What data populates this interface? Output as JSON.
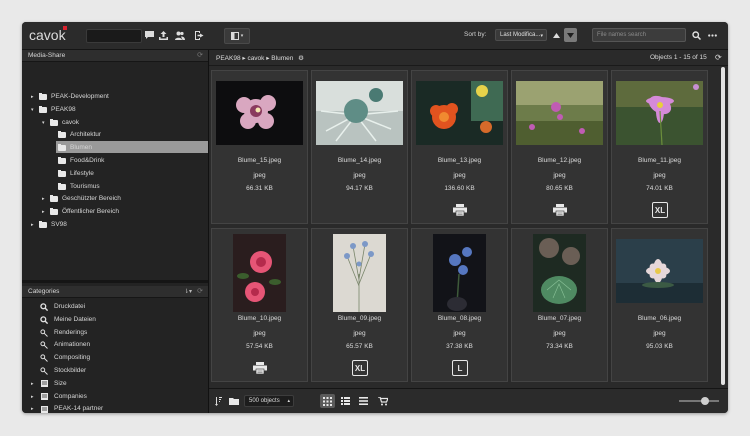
{
  "app": {
    "logo": "cavok"
  },
  "toolbar": {
    "sort_label": "Sort by:",
    "sort_value": "Last Modifica...",
    "search_placeholder": "File names search"
  },
  "media_share": {
    "title": "Media-Share",
    "tree": [
      {
        "label": "PEAK-Development",
        "level": 0,
        "expanded": false
      },
      {
        "label": "PEAK98",
        "level": 0,
        "expanded": true
      },
      {
        "label": "cavok",
        "level": 1,
        "expanded": true
      },
      {
        "label": "Architektur",
        "level": 2,
        "expanded": false
      },
      {
        "label": "Blumen",
        "level": 2,
        "expanded": false,
        "selected": true
      },
      {
        "label": "Food&Drink",
        "level": 2,
        "expanded": false
      },
      {
        "label": "Lifestyle",
        "level": 2,
        "expanded": false
      },
      {
        "label": "Tourismus",
        "level": 2,
        "expanded": false
      },
      {
        "label": "Geschützter Bereich",
        "level": 1,
        "expanded": false
      },
      {
        "label": "Öffentlicher Bereich",
        "level": 1,
        "expanded": false
      },
      {
        "label": "SV98",
        "level": 0,
        "expanded": false
      }
    ]
  },
  "categories": {
    "title": "Categories",
    "items": [
      {
        "label": "Druckdatei",
        "icon": "search-icon"
      },
      {
        "label": "Meine Dateien",
        "icon": "search-icon"
      },
      {
        "label": "Renderings",
        "icon": "smart-search-icon"
      },
      {
        "label": "Animationen",
        "icon": "smart-search-icon"
      },
      {
        "label": "Compositing",
        "icon": "smart-search-icon"
      },
      {
        "label": "Stockbilder",
        "icon": "smart-search-icon"
      },
      {
        "label": "Size",
        "icon": "list-icon"
      },
      {
        "label": "Companies",
        "icon": "list-icon"
      },
      {
        "label": "PEAK-14 partner",
        "icon": "list-icon"
      },
      {
        "label": "Dogawist Marketing",
        "icon": "list-icon"
      }
    ]
  },
  "breadcrumb": {
    "text": "PEAK98 ▸ cavok ▸ Blumen"
  },
  "objects": {
    "count_text": "Objects 1 - 15 of 15"
  },
  "files": [
    {
      "name": "Blume_15.jpeg",
      "type": "jpeg",
      "size": "66.31 KB",
      "icon": ""
    },
    {
      "name": "Blume_14.jpeg",
      "type": "jpeg",
      "size": "94.17 KB",
      "icon": ""
    },
    {
      "name": "Blume_13.jpeg",
      "type": "jpeg",
      "size": "136.60 KB",
      "icon": "printer-icon"
    },
    {
      "name": "Blume_12.jpeg",
      "type": "jpeg",
      "size": "80.65 KB",
      "icon": "printer-icon"
    },
    {
      "name": "Blume_11.jpeg",
      "type": "jpeg",
      "size": "74.01 KB",
      "icon": "xl-icon",
      "icon_text": "XL"
    },
    {
      "name": "Blume_10.jpeg",
      "type": "jpeg",
      "size": "57.54 KB",
      "icon": "printer-icon"
    },
    {
      "name": "Blume_09.jpeg",
      "type": "jpeg",
      "size": "65.57 KB",
      "icon": "xl-icon",
      "icon_text": "XL"
    },
    {
      "name": "Blume_08.jpeg",
      "type": "jpeg",
      "size": "37.38 KB",
      "icon": "l-icon",
      "icon_text": "L"
    },
    {
      "name": "Blume_07.jpeg",
      "type": "jpeg",
      "size": "73.34 KB",
      "icon": ""
    },
    {
      "name": "Blume_06.jpeg",
      "type": "jpeg",
      "size": "95.03 KB",
      "icon": ""
    }
  ],
  "bottombar": {
    "per_page": "500 objects"
  }
}
